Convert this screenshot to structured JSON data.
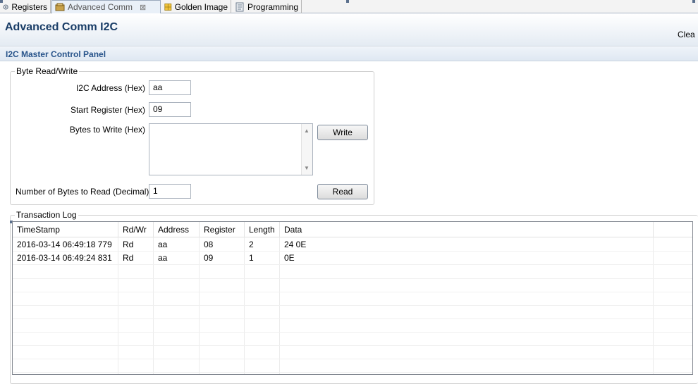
{
  "tabs": [
    {
      "label": "Registers",
      "icon": "registers-icon",
      "active": false
    },
    {
      "label": "Advanced Comm",
      "icon": "advanced-comm-icon",
      "active": true,
      "closable": true
    },
    {
      "label": "Golden Image",
      "icon": "golden-image-icon",
      "active": false
    },
    {
      "label": "Programming",
      "icon": "programming-icon",
      "active": false
    }
  ],
  "header": {
    "title": "Advanced Comm I2C",
    "clear_label": "Clea"
  },
  "section": {
    "title": "I2C Master Control Panel"
  },
  "byte_rw": {
    "legend": "Byte Read/Write",
    "address_label": "I2C Address (Hex)",
    "address_value": "aa",
    "start_label": "Start Register (Hex)",
    "start_value": "09",
    "bytes_write_label": "Bytes to Write (Hex)",
    "bytes_write_value": "",
    "write_button": "Write",
    "num_read_label": "Number of Bytes to Read (Decimal)",
    "num_read_value": "1",
    "read_button": "Read"
  },
  "log": {
    "legend": "Transaction Log",
    "columns": [
      "TimeStamp",
      "Rd/Wr",
      "Address",
      "Register",
      "Length",
      "Data"
    ],
    "rows": [
      [
        "2016-03-14 06:49:18 779",
        "Rd",
        "aa",
        "08",
        "2",
        "24 0E"
      ],
      [
        "2016-03-14 06:49:24 831",
        "Rd",
        "aa",
        "09",
        "1",
        "0E"
      ]
    ]
  },
  "colors": {
    "title": "#183c66",
    "section_title": "#27538a",
    "tab_active_bg": "#e9f0f8"
  }
}
